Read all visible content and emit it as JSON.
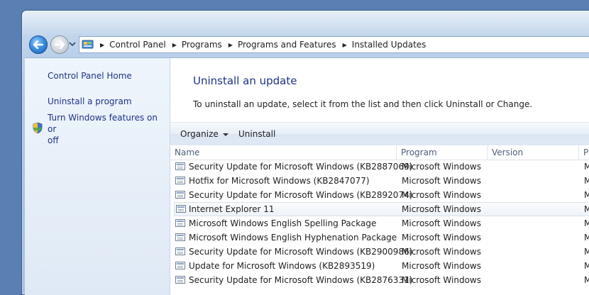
{
  "address": {
    "crumbs": [
      "Control Panel",
      "Programs",
      "Programs and Features",
      "Installed Updates"
    ]
  },
  "sidebar": {
    "home": "Control Panel Home",
    "uninstall_program": "Uninstall a program",
    "features_line1": "Turn Windows features on or",
    "features_line2": "off"
  },
  "main": {
    "title": "Uninstall an update",
    "description": "To uninstall an update, select it from the list and then click Uninstall or Change."
  },
  "toolbar": {
    "organize": "Organize",
    "uninstall": "Uninstall"
  },
  "columns": {
    "name": "Name",
    "program": "Program",
    "version": "Version",
    "publisher_cut": "P"
  },
  "updates": [
    {
      "name": "Security Update for Microsoft Windows (KB2887069)",
      "program": "Microsoft Windows",
      "publisher_cut": "M"
    },
    {
      "name": "Hotfix for Microsoft Windows (KB2847077)",
      "program": "Microsoft Windows",
      "publisher_cut": "M"
    },
    {
      "name": "Security Update for Microsoft Windows (KB2892074)",
      "program": "Microsoft Windows",
      "publisher_cut": "M"
    },
    {
      "name": "Internet Explorer 11",
      "program": "Microsoft Windows",
      "publisher_cut": "M",
      "selected": true
    },
    {
      "name": "Microsoft Windows English Spelling Package",
      "program": "Microsoft Windows",
      "publisher_cut": "M"
    },
    {
      "name": "Microsoft Windows English Hyphenation Package",
      "program": "Microsoft Windows",
      "publisher_cut": "M"
    },
    {
      "name": "Security Update for Microsoft Windows (KB2900986)",
      "program": "Microsoft Windows",
      "publisher_cut": "M"
    },
    {
      "name": "Update for Microsoft Windows (KB2893519)",
      "program": "Microsoft Windows",
      "publisher_cut": "M"
    },
    {
      "name": "Security Update for Microsoft Windows (KB2876331)",
      "program": "Microsoft Windows",
      "publisher_cut": "M"
    }
  ],
  "icons": [
    "back-arrow-icon",
    "forward-arrow-icon",
    "history-dropdown-icon",
    "control-panel-icon",
    "shield-icon",
    "update-icon"
  ],
  "colors": {
    "link": "#1e3287",
    "accent": "#3c8fe0"
  }
}
